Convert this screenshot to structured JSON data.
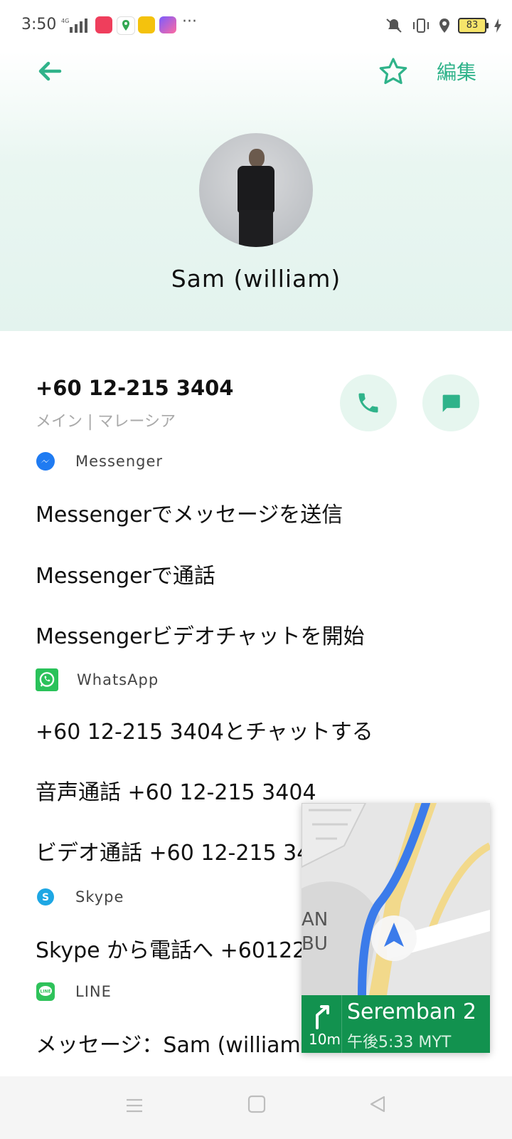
{
  "status_bar": {
    "time": "3:50",
    "network": "4G",
    "more": "···",
    "battery": "83"
  },
  "header": {
    "edit_label": "編集"
  },
  "contact": {
    "name": "Sam (william)"
  },
  "phone": {
    "number": "+60 12-215 3404",
    "subtitle": "メイン | マレーシア"
  },
  "sections": {
    "messenger": {
      "label": "Messenger",
      "actions": [
        "Messengerでメッセージを送信",
        "Messengerで通話",
        "Messengerビデオチャットを開始"
      ]
    },
    "whatsapp": {
      "label": "WhatsApp",
      "actions": [
        "+60 12-215 3404とチャットする",
        "音声通話 +60 12-215 3404",
        "ビデオ通話 +60 12-215 34"
      ]
    },
    "skype": {
      "label": "Skype",
      "actions": [
        "Skype から電話へ +60122"
      ]
    },
    "line": {
      "label": "LINE",
      "actions": [
        "メッセージ：Sam (william"
      ]
    }
  },
  "map_overlay": {
    "destination": "Seremban 2",
    "distance": "10m",
    "eta": "午後5:33 MYT",
    "map_text_1": "AN",
    "map_text_2": "BU"
  },
  "colors": {
    "accent": "#2fb38a",
    "nav_green": "#12924f",
    "route_blue": "#3b7bea"
  }
}
